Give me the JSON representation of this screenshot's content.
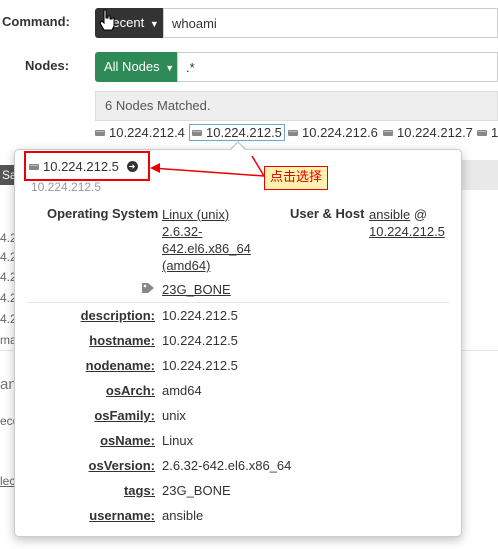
{
  "form": {
    "command_label": "Command:",
    "recent_label": "Recent",
    "command_value": "whoami",
    "nodes_label": "Nodes:",
    "all_nodes_label": "All Nodes",
    "filter_value": ".*",
    "matched_text": "6 Nodes Matched."
  },
  "nodes": [
    "10.224.212.4",
    "10.224.212.5",
    "10.224.212.6",
    "10.224.212.7",
    "1"
  ],
  "left_fragments": [
    "Sa",
    "4.2",
    "4.2",
    "4.2",
    "4.2",
    "4.2",
    "ma",
    "an",
    "ece",
    "lec"
  ],
  "popover": {
    "node_name": "10.224.212.5",
    "node_sub": "10.224.212.5",
    "os_header": "Operating System",
    "os_lines": [
      "Linux (unix)",
      "2.6.32-",
      "642.el6.x86_64",
      "(amd64)"
    ],
    "user_header": "User & Host",
    "user_link": "ansible",
    "user_at": "@",
    "host_link": "10.224.212.5",
    "tag": "23G_BONE",
    "attributes": [
      {
        "key": "description:",
        "value": "10.224.212.5"
      },
      {
        "key": "hostname:",
        "value": "10.224.212.5"
      },
      {
        "key": "nodename:",
        "value": "10.224.212.5"
      },
      {
        "key": "osArch:",
        "value": "amd64"
      },
      {
        "key": "osFamily:",
        "value": "unix"
      },
      {
        "key": "osName:",
        "value": "Linux"
      },
      {
        "key": "osVersion:",
        "value": "2.6.32-642.el6.x86_64"
      },
      {
        "key": "tags:",
        "value": "23G_BONE"
      },
      {
        "key": "username:",
        "value": "ansible"
      }
    ]
  },
  "annotation": {
    "label": "点击选择"
  },
  "colors": {
    "green": "#2e8b57",
    "dark": "#333333",
    "annotation_red": "#e00000",
    "annotation_bg": "#fff2b0"
  },
  "icons": {
    "server": "server-icon",
    "arrow": "arrow-circle-right-icon",
    "tag": "tag-icon",
    "caret": "caret-down-icon",
    "cursor": "hand-cursor-icon"
  }
}
